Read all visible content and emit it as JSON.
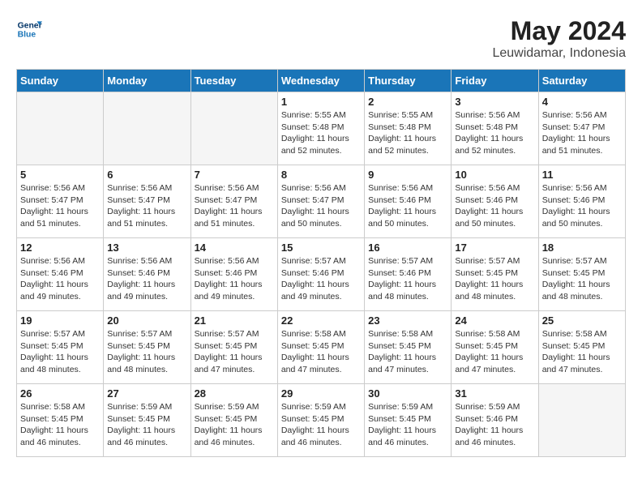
{
  "logo": {
    "line1": "General",
    "line2": "Blue"
  },
  "title": "May 2024",
  "location": "Leuwidamar, Indonesia",
  "weekdays": [
    "Sunday",
    "Monday",
    "Tuesday",
    "Wednesday",
    "Thursday",
    "Friday",
    "Saturday"
  ],
  "days": {
    "1": {
      "sunrise": "5:55 AM",
      "sunset": "5:48 PM",
      "daylight": "11 hours and 52 minutes."
    },
    "2": {
      "sunrise": "5:55 AM",
      "sunset": "5:48 PM",
      "daylight": "11 hours and 52 minutes."
    },
    "3": {
      "sunrise": "5:56 AM",
      "sunset": "5:48 PM",
      "daylight": "11 hours and 52 minutes."
    },
    "4": {
      "sunrise": "5:56 AM",
      "sunset": "5:47 PM",
      "daylight": "11 hours and 51 minutes."
    },
    "5": {
      "sunrise": "5:56 AM",
      "sunset": "5:47 PM",
      "daylight": "11 hours and 51 minutes."
    },
    "6": {
      "sunrise": "5:56 AM",
      "sunset": "5:47 PM",
      "daylight": "11 hours and 51 minutes."
    },
    "7": {
      "sunrise": "5:56 AM",
      "sunset": "5:47 PM",
      "daylight": "11 hours and 51 minutes."
    },
    "8": {
      "sunrise": "5:56 AM",
      "sunset": "5:47 PM",
      "daylight": "11 hours and 50 minutes."
    },
    "9": {
      "sunrise": "5:56 AM",
      "sunset": "5:46 PM",
      "daylight": "11 hours and 50 minutes."
    },
    "10": {
      "sunrise": "5:56 AM",
      "sunset": "5:46 PM",
      "daylight": "11 hours and 50 minutes."
    },
    "11": {
      "sunrise": "5:56 AM",
      "sunset": "5:46 PM",
      "daylight": "11 hours and 50 minutes."
    },
    "12": {
      "sunrise": "5:56 AM",
      "sunset": "5:46 PM",
      "daylight": "11 hours and 49 minutes."
    },
    "13": {
      "sunrise": "5:56 AM",
      "sunset": "5:46 PM",
      "daylight": "11 hours and 49 minutes."
    },
    "14": {
      "sunrise": "5:56 AM",
      "sunset": "5:46 PM",
      "daylight": "11 hours and 49 minutes."
    },
    "15": {
      "sunrise": "5:57 AM",
      "sunset": "5:46 PM",
      "daylight": "11 hours and 49 minutes."
    },
    "16": {
      "sunrise": "5:57 AM",
      "sunset": "5:46 PM",
      "daylight": "11 hours and 48 minutes."
    },
    "17": {
      "sunrise": "5:57 AM",
      "sunset": "5:45 PM",
      "daylight": "11 hours and 48 minutes."
    },
    "18": {
      "sunrise": "5:57 AM",
      "sunset": "5:45 PM",
      "daylight": "11 hours and 48 minutes."
    },
    "19": {
      "sunrise": "5:57 AM",
      "sunset": "5:45 PM",
      "daylight": "11 hours and 48 minutes."
    },
    "20": {
      "sunrise": "5:57 AM",
      "sunset": "5:45 PM",
      "daylight": "11 hours and 48 minutes."
    },
    "21": {
      "sunrise": "5:57 AM",
      "sunset": "5:45 PM",
      "daylight": "11 hours and 47 minutes."
    },
    "22": {
      "sunrise": "5:58 AM",
      "sunset": "5:45 PM",
      "daylight": "11 hours and 47 minutes."
    },
    "23": {
      "sunrise": "5:58 AM",
      "sunset": "5:45 PM",
      "daylight": "11 hours and 47 minutes."
    },
    "24": {
      "sunrise": "5:58 AM",
      "sunset": "5:45 PM",
      "daylight": "11 hours and 47 minutes."
    },
    "25": {
      "sunrise": "5:58 AM",
      "sunset": "5:45 PM",
      "daylight": "11 hours and 47 minutes."
    },
    "26": {
      "sunrise": "5:58 AM",
      "sunset": "5:45 PM",
      "daylight": "11 hours and 46 minutes."
    },
    "27": {
      "sunrise": "5:59 AM",
      "sunset": "5:45 PM",
      "daylight": "11 hours and 46 minutes."
    },
    "28": {
      "sunrise": "5:59 AM",
      "sunset": "5:45 PM",
      "daylight": "11 hours and 46 minutes."
    },
    "29": {
      "sunrise": "5:59 AM",
      "sunset": "5:45 PM",
      "daylight": "11 hours and 46 minutes."
    },
    "30": {
      "sunrise": "5:59 AM",
      "sunset": "5:45 PM",
      "daylight": "11 hours and 46 minutes."
    },
    "31": {
      "sunrise": "5:59 AM",
      "sunset": "5:46 PM",
      "daylight": "11 hours and 46 minutes."
    }
  }
}
